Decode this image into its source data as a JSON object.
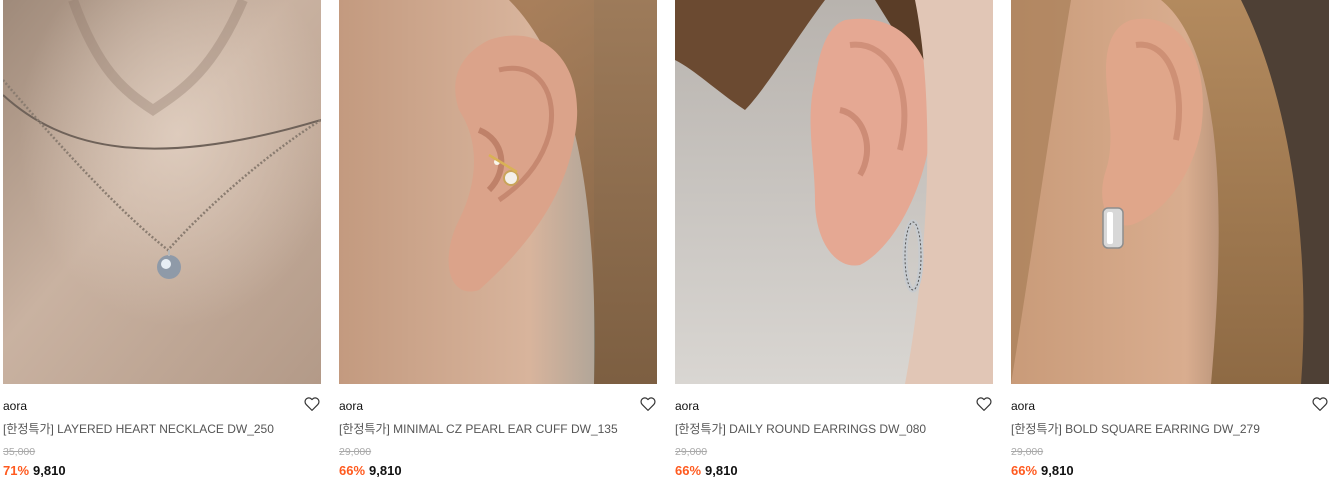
{
  "colors": {
    "discount": "#ff5a1f",
    "price": "#111111",
    "original_price": "#aaaaaa",
    "product_name": "#555555"
  },
  "products": [
    {
      "image_subject": "layered-heart-necklace-photo",
      "brand": "aora",
      "name": "[한정특가] LAYERED HEART NECKLACE DW_250",
      "original_price": "35,000",
      "discount": "71%",
      "price": "9,810",
      "wishlist_icon": "heart-outline-icon"
    },
    {
      "image_subject": "pearl-ear-cuff-photo",
      "brand": "aora",
      "name": "[한정특가] MINIMAL CZ PEARL EAR CUFF DW_135",
      "original_price": "29,000",
      "discount": "66%",
      "price": "9,810",
      "wishlist_icon": "heart-outline-icon"
    },
    {
      "image_subject": "round-hoop-earring-photo",
      "brand": "aora",
      "name": "[한정특가] DAILY ROUND EARRINGS DW_080",
      "original_price": "29,000",
      "discount": "66%",
      "price": "9,810",
      "wishlist_icon": "heart-outline-icon"
    },
    {
      "image_subject": "square-earring-photo",
      "brand": "aora",
      "name": "[한정특가] BOLD SQUARE EARRING DW_279",
      "original_price": "29,000",
      "discount": "66%",
      "price": "9,810",
      "wishlist_icon": "heart-outline-icon"
    }
  ]
}
